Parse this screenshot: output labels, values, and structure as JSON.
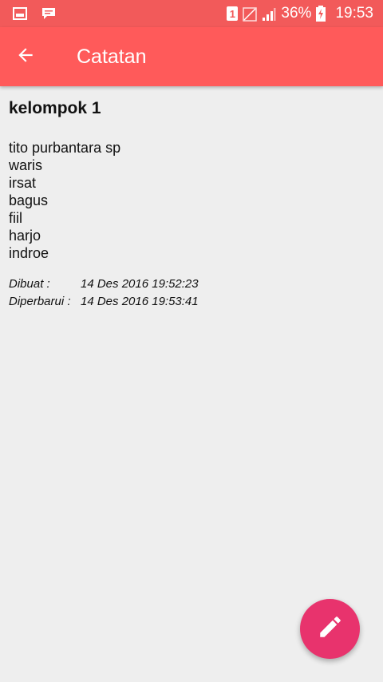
{
  "status_bar": {
    "sim_label": "1",
    "battery": "36%",
    "time": "19:53",
    "icons": [
      "gallery-icon",
      "message-icon",
      "sim-icon",
      "no-signal-icon",
      "signal-icon",
      "battery-charging-icon"
    ]
  },
  "app_bar": {
    "title": "Catatan",
    "back_icon": "arrow-back-icon",
    "color": "#ff5a5a"
  },
  "note": {
    "title": "kelompok 1",
    "lines": [
      "tito purbantara sp",
      "waris",
      "irsat",
      "bagus",
      "fiil",
      "harjo",
      "indroe"
    ],
    "created_label": "Dibuat :",
    "created_value": "14 Des 2016 19:52:23",
    "updated_label": "Diperbarui :",
    "updated_value": "14 Des 2016 19:53:41"
  },
  "fab": {
    "icon": "pencil-icon",
    "color": "#e8336d"
  }
}
